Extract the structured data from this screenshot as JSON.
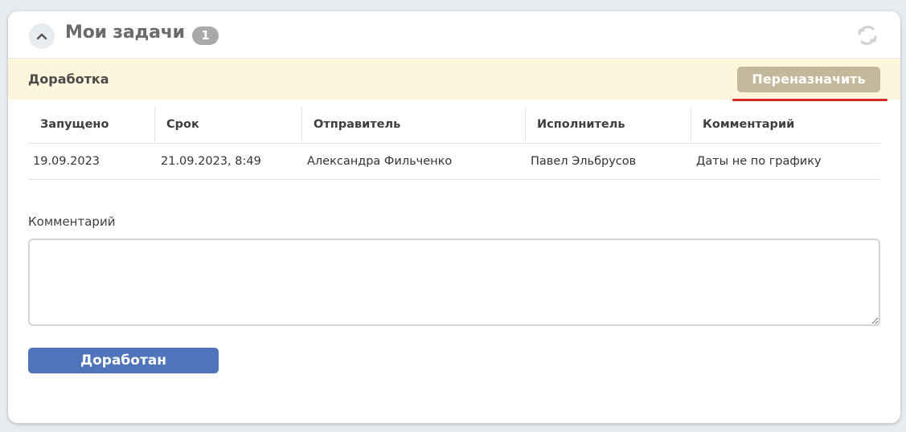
{
  "header": {
    "title": "Мои задачи",
    "count": "1",
    "collapse_icon": "chevron-up-icon",
    "refresh_icon": "refresh-icon"
  },
  "stage": {
    "title": "Доработка",
    "reassign_label": "Переназначить"
  },
  "table": {
    "columns": [
      "Запущено",
      "Срок",
      "Отправитель",
      "Исполнитель",
      "Комментарий"
    ],
    "rows": [
      [
        "19.09.2023",
        "21.09.2023, 8:49",
        "Александра Фильченко",
        "Павел Эльбрусов",
        "Даты не по графику"
      ]
    ]
  },
  "comment": {
    "label": "Комментарий",
    "value": "",
    "placeholder": ""
  },
  "actions": {
    "done_label": "Доработан"
  },
  "colors": {
    "stage_bg": "#fdf6dd",
    "reassign_bg": "#c3b99a",
    "done_bg": "#4f74b9",
    "badge_bg": "#a9a9a9",
    "accent_underline": "#d42a2a"
  }
}
